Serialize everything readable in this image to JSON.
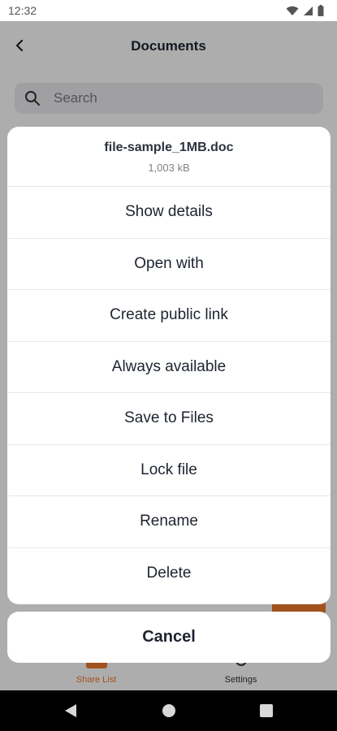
{
  "status_bar": {
    "time": "12:32",
    "icons": [
      "wifi-icon",
      "signal-icon",
      "battery-icon"
    ]
  },
  "header": {
    "title": "Documents",
    "back_icon": "chevron-left-icon"
  },
  "search": {
    "placeholder": "Search",
    "icon": "search-icon"
  },
  "tabs": [
    {
      "label": "Share List",
      "icon": "share-list-icon",
      "active": true
    },
    {
      "label": "Settings",
      "icon": "gear-icon",
      "active": false
    }
  ],
  "sheet": {
    "file_name": "file-sample_1MB.doc",
    "file_size": "1,003 kB",
    "actions": [
      "Show details",
      "Open with",
      "Create public link",
      "Always available",
      "Save to Files",
      "Lock file",
      "Rename",
      "Delete"
    ],
    "cancel_label": "Cancel"
  },
  "nav": [
    "back-triangle-icon",
    "home-circle-icon",
    "recents-square-icon"
  ],
  "colors": {
    "accent": "#ef7a2a",
    "text": "#1d2430",
    "scrim": "rgba(0,0,0,0.32)"
  }
}
